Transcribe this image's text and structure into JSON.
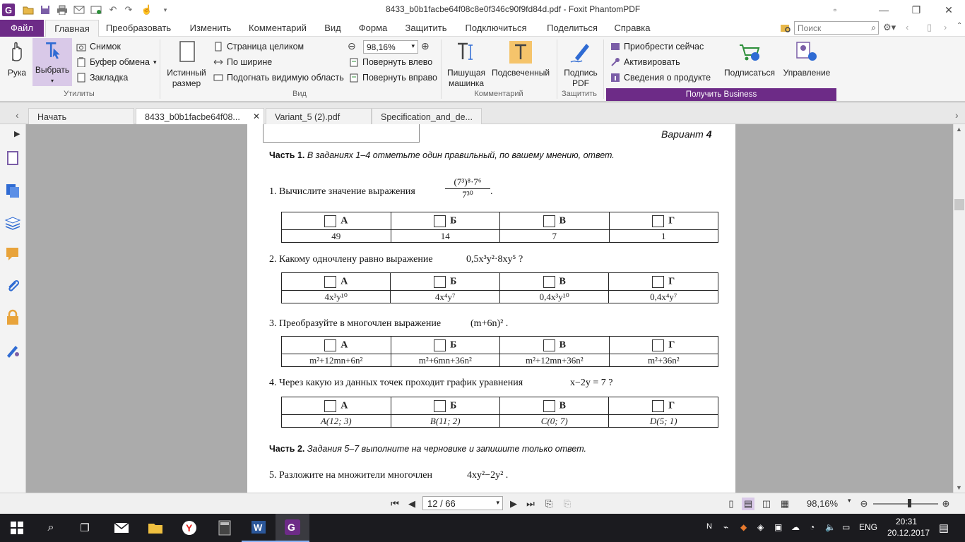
{
  "window": {
    "title": "8433_b0b1facbe64f08c8e0f346c90f9fd84d.pdf - Foxit PhantomPDF"
  },
  "menu": {
    "tabs": [
      "Файл",
      "Главная",
      "Преобразовать",
      "Изменить",
      "Комментарий",
      "Вид",
      "Форма",
      "Защитить",
      "Подключиться",
      "Поделиться",
      "Справка"
    ],
    "search_placeholder": "Поиск"
  },
  "ribbon": {
    "hand": "Рука",
    "select": "Выбрать",
    "snapshot": "Снимок",
    "clipboard": "Буфер обмена",
    "bookmark": "Закладка",
    "group_utilities": "Утилиты",
    "actual_size": "Истинный размер",
    "fit_page": "Страница целиком",
    "fit_width": "По ширине",
    "fit_visible": "Подогнать видимую область",
    "zoom_value": "98,16%",
    "rotate_left": "Повернуть влево",
    "rotate_right": "Повернуть вправо",
    "group_view": "Вид",
    "typewriter": "Пишущая машинка",
    "highlight": "Подсвеченный",
    "group_comment": "Комментарий",
    "sign_pdf": "Подпись PDF",
    "group_protect": "Защитить",
    "buy_now": "Приобрести сейчас",
    "activate": "Активировать",
    "product_info": "Сведения о продукте",
    "subscribe": "Подписаться",
    "manage": "Управление",
    "get_business": "Получить Business"
  },
  "doc_tabs": [
    {
      "label": "Начать",
      "active": false
    },
    {
      "label": "8433_b0b1facbe64f08...",
      "active": true
    },
    {
      "label": "Variant_5 (2).pdf",
      "active": false
    },
    {
      "label": "Specification_and_de...",
      "active": false
    }
  ],
  "page": {
    "variant_label": "Вариант",
    "variant_num": "4",
    "part1_label": "Часть 1.",
    "part1_text": "В заданиях 1–4 отметьте один правильный, по вашему мнению, ответ.",
    "q1": "1. Вычислите значение выражения",
    "q1_expr_num": "(7³)⁸·7⁶",
    "q1_expr_den": "7³⁰",
    "q2": "2. Какому одночлену равно выражение",
    "q2_expr": "0,5x³y²·8xy⁵ ?",
    "q3": "3. Преобразуйте в многочлен выражение",
    "q3_expr": "(m+6n)² .",
    "q4": "4. Через какую из данных точек проходит график уравнения",
    "q4_expr": "x−2y = 7 ?",
    "part2_label": "Часть 2.",
    "part2_text": "Задания 5–7 выполните на черновике и запишите только ответ.",
    "q5": "5. Разложите на множители многочлен",
    "q5_expr": "4xy²−2y² .",
    "headers": [
      "А",
      "Б",
      "В",
      "Г"
    ],
    "q1_answers": [
      "49",
      "14",
      "7",
      "1"
    ],
    "q2_answers": [
      "4x³y¹⁰",
      "4x⁴y⁷",
      "0,4x³y¹⁰",
      "0,4x⁴y⁷"
    ],
    "q3_answers": [
      "m²+12mn+6n²",
      "m²+6mn+36n²",
      "m²+12mn+36n²",
      "m²+36n²"
    ],
    "q4_answers": [
      "A(12; 3)",
      "B(11; 2)",
      "C(0; 7)",
      "D(5; 1)"
    ]
  },
  "status": {
    "page_indicator": "12 / 66",
    "zoom": "98,16%",
    "zoom_slider_fraction": 0.55
  },
  "taskbar": {
    "lang": "ENG",
    "time": "20:31",
    "date": "20.12.2017"
  },
  "colors": {
    "foxit_purple": "#6d2b87",
    "select_highlight": "#d9c9e8",
    "taskbar": "#1b1b1f"
  }
}
